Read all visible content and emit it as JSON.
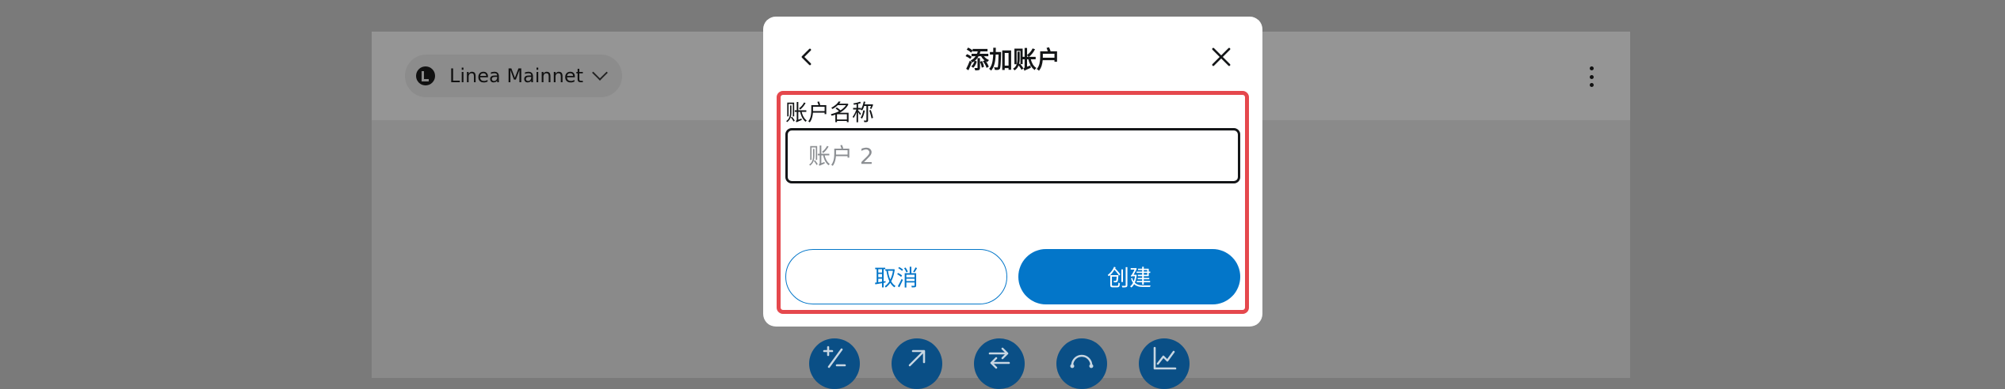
{
  "background": {
    "network": {
      "label": "Linea Mainnet",
      "logo_icon": "linea-logo-icon",
      "dropdown_icon": "chevron-down-icon"
    },
    "menu_icon": "kebab-menu-icon",
    "actions": [
      {
        "icon": "buy-sell-icon",
        "glyph": "+/−"
      },
      {
        "icon": "send-arrow-icon"
      },
      {
        "icon": "swap-arrows-icon"
      },
      {
        "icon": "bridge-icon"
      },
      {
        "icon": "portfolio-chart-icon"
      }
    ]
  },
  "modal": {
    "title": "添加账户",
    "back_icon": "chevron-left-icon",
    "close_icon": "close-icon",
    "field_label": "账户名称",
    "input_value": "",
    "input_placeholder": "账户 2",
    "cancel_label": "取消",
    "create_label": "创建"
  },
  "colors": {
    "primary": "#0376c9",
    "highlight": "#e5484d",
    "text": "#141618",
    "overlay": "#7a7a7a"
  }
}
